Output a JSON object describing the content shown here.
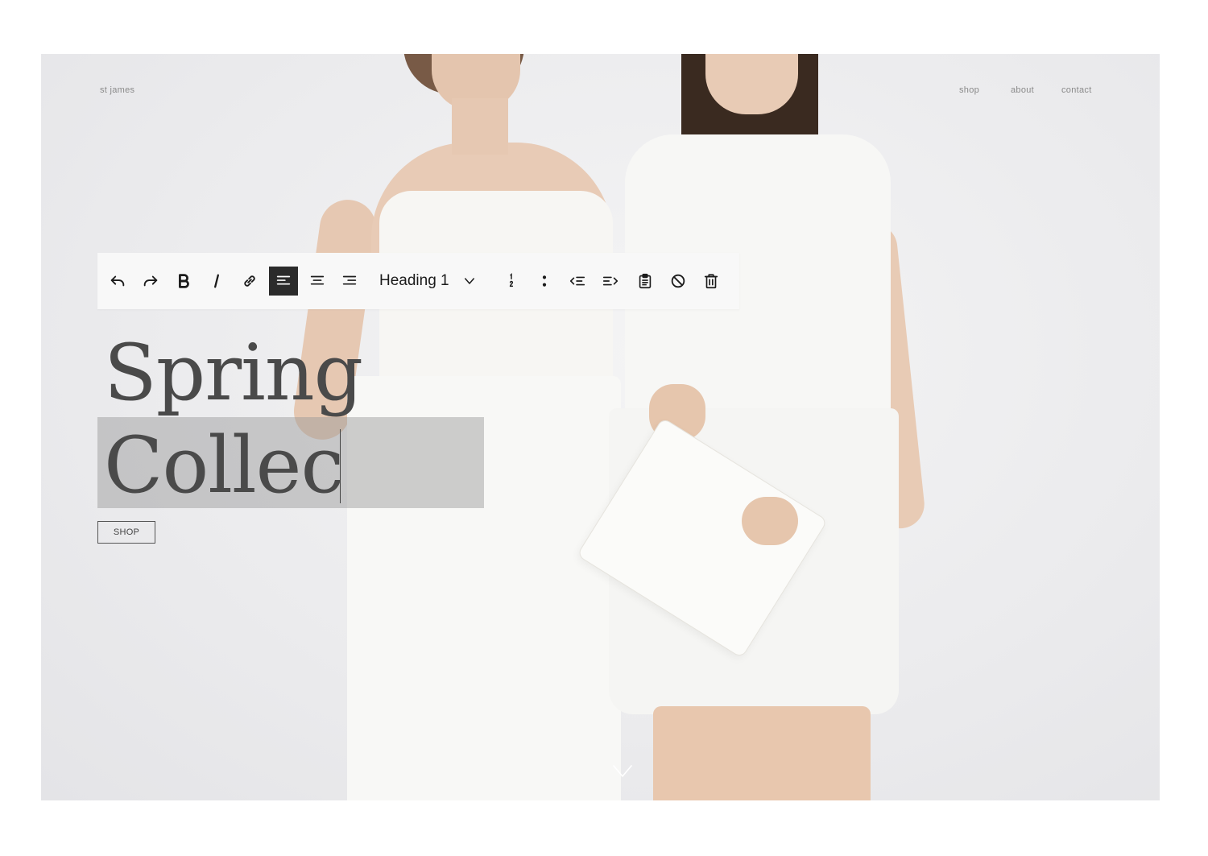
{
  "site": {
    "brand": "st james",
    "nav": [
      "shop",
      "about",
      "contact"
    ]
  },
  "toolbar": {
    "buttons": [
      {
        "name": "undo-icon",
        "active": false
      },
      {
        "name": "redo-icon",
        "active": false
      },
      {
        "name": "bold-icon",
        "active": false
      },
      {
        "name": "italic-icon",
        "active": false
      },
      {
        "name": "link-icon",
        "active": false
      },
      {
        "name": "align-left-icon",
        "active": true
      },
      {
        "name": "align-center-icon",
        "active": false
      },
      {
        "name": "align-right-icon",
        "active": false
      }
    ],
    "heading_select": "Heading 1",
    "buttons_after": [
      {
        "name": "ordered-list-icon"
      },
      {
        "name": "unordered-list-icon"
      },
      {
        "name": "outdent-icon"
      },
      {
        "name": "indent-icon"
      },
      {
        "name": "paste-icon"
      },
      {
        "name": "clear-format-icon"
      },
      {
        "name": "delete-icon"
      }
    ]
  },
  "hero": {
    "headline_line1": "Spring",
    "headline_line2": "Collec",
    "cta_label": "SHOP"
  },
  "colors": {
    "hero_bg": "#ebebed",
    "toolbar_bg": "#f8f8f8",
    "active_button": "#2b2b2b",
    "headline_text": "#4a4a4a",
    "selection": "#969696"
  }
}
